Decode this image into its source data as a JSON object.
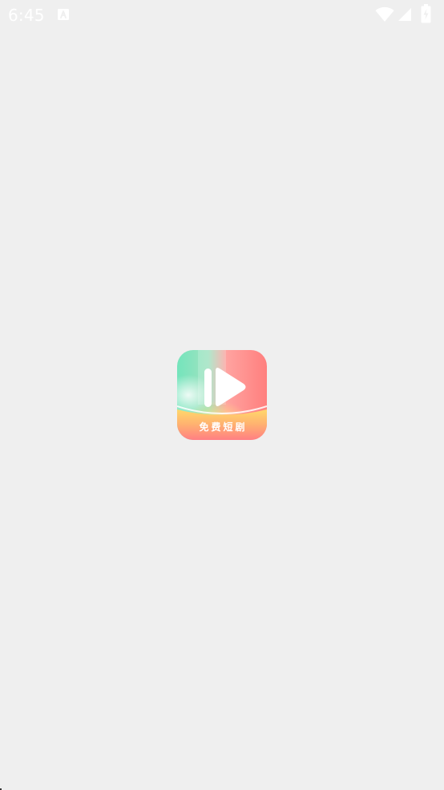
{
  "status_bar": {
    "time": "6:45",
    "notification_icon": "a-letter-icon",
    "wifi_icon": "wifi-icon",
    "signal_icon": "cell-signal-icon",
    "battery_icon": "battery-charging-icon"
  },
  "splash": {
    "logo_icon": "play-logo-icon",
    "caption": "免费短剧"
  },
  "colors": {
    "background": "#efefef",
    "accent_red": "#ff7d7a",
    "accent_green": "#74e4bc",
    "accent_yellow": "#ffc966"
  }
}
